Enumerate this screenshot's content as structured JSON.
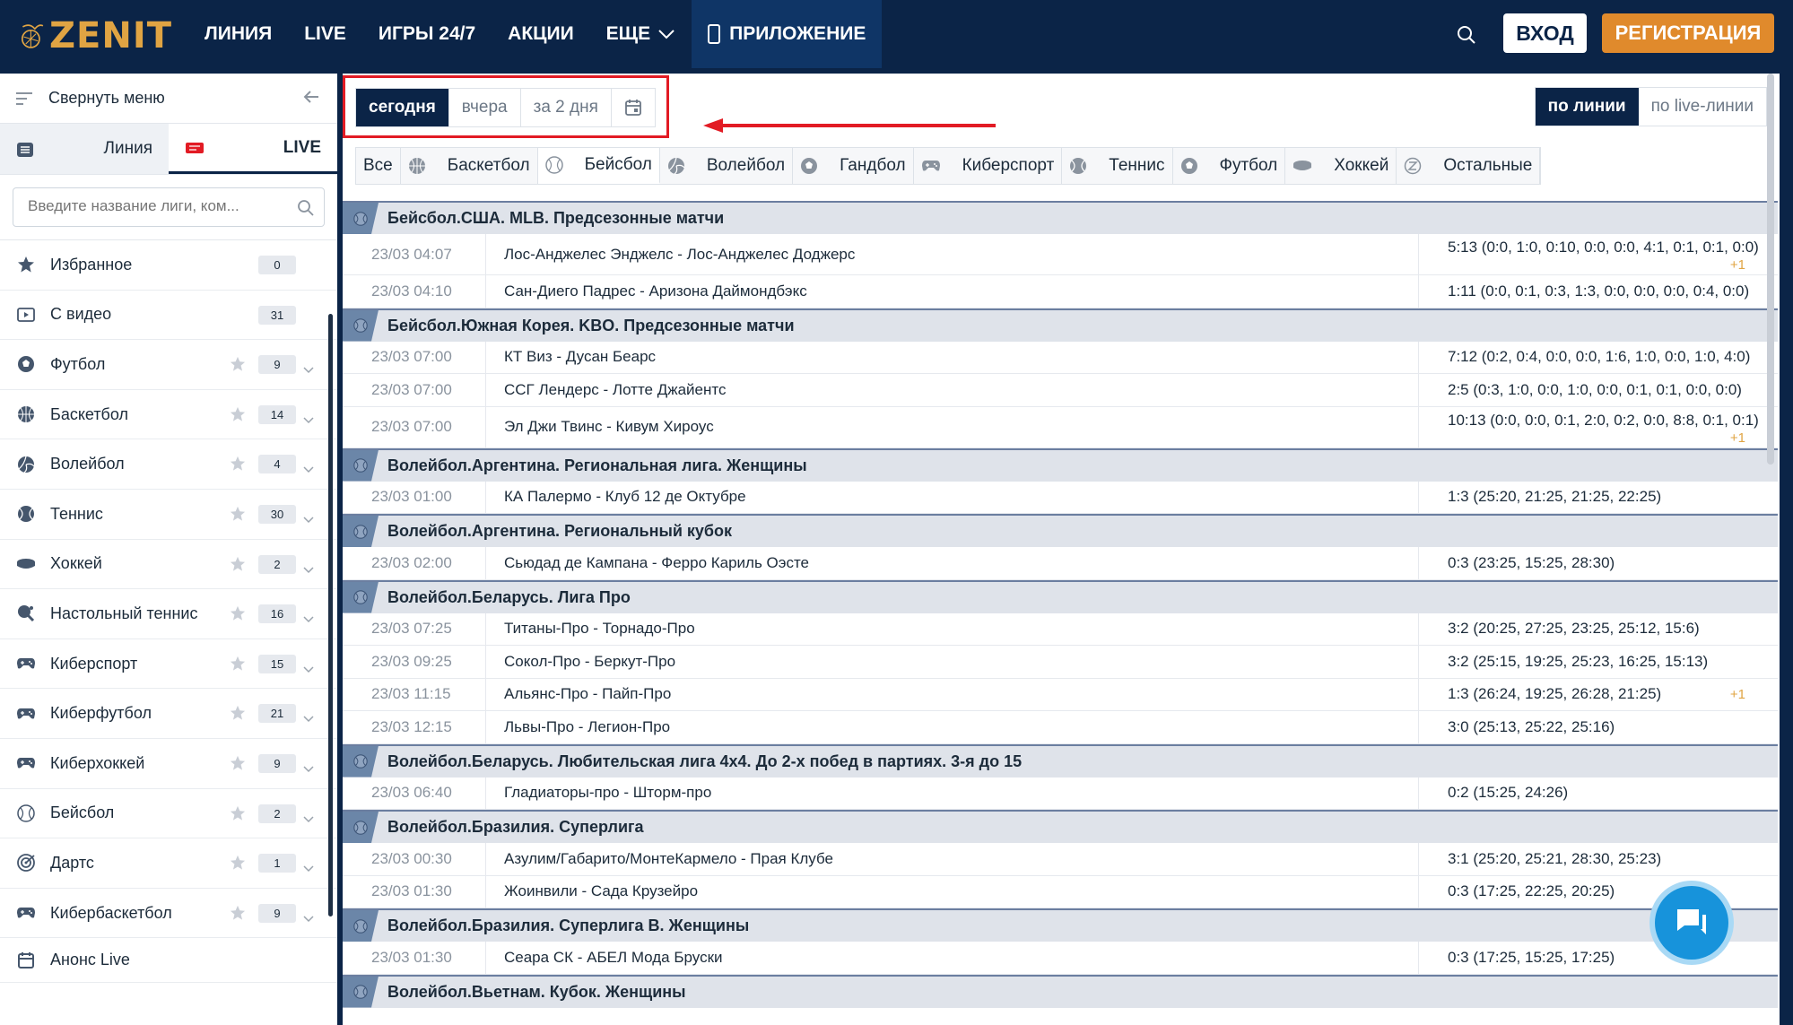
{
  "header": {
    "brand": "ZENIT",
    "nav": [
      "ЛИНИЯ",
      "LIVE",
      "ИГРЫ 24/7",
      "АКЦИИ",
      "ЕЩЕ"
    ],
    "app_label": "ПРИЛОЖЕНИЕ",
    "login_label": "ВХОД",
    "register_label": "РЕГИСТРАЦИЯ",
    "colors": {
      "bg": "#0b2447",
      "brand": "#e0a443",
      "register": "#e08a2c"
    }
  },
  "sidebar": {
    "collapse_label": "Свернуть меню",
    "tab_line": "Линия",
    "tab_live": "LIVE",
    "search_placeholder": "Введите название лиги, ком...",
    "items": [
      {
        "label": "Избранное",
        "count": "0",
        "icon": "star-icon",
        "star": false
      },
      {
        "label": "С видео",
        "count": "31",
        "icon": "video-icon",
        "star": false
      },
      {
        "label": "Футбол",
        "count": "9",
        "icon": "football-icon",
        "star": true
      },
      {
        "label": "Баскетбол",
        "count": "14",
        "icon": "basketball-icon",
        "star": true
      },
      {
        "label": "Волейбол",
        "count": "4",
        "icon": "volleyball-icon",
        "star": true
      },
      {
        "label": "Теннис",
        "count": "30",
        "icon": "tennis-icon",
        "star": true
      },
      {
        "label": "Хоккей",
        "count": "2",
        "icon": "hockey-icon",
        "star": true
      },
      {
        "label": "Настольный теннис",
        "count": "16",
        "icon": "table-tennis-icon",
        "star": true
      },
      {
        "label": "Киберспорт",
        "count": "15",
        "icon": "gamepad-icon",
        "star": true
      },
      {
        "label": "Киберфутбол",
        "count": "21",
        "icon": "gamepad-icon",
        "star": true
      },
      {
        "label": "Киберхоккей",
        "count": "9",
        "icon": "gamepad-icon",
        "star": true
      },
      {
        "label": "Бейсбол",
        "count": "2",
        "icon": "baseball-icon",
        "star": true
      },
      {
        "label": "Дартс",
        "count": "1",
        "icon": "darts-icon",
        "star": true
      },
      {
        "label": "Кибербаскетбол",
        "count": "9",
        "icon": "gamepad-icon",
        "star": true
      }
    ],
    "anons_label": "Анонс Live"
  },
  "filters": {
    "dates": [
      "сегодня",
      "вчера",
      "за 2 дня"
    ],
    "modes": [
      "по линии",
      "по live-линии"
    ]
  },
  "sport_tabs": [
    "Все",
    "Баскетбол",
    "Бейсбол",
    "Волейбол",
    "Гандбол",
    "Киберспорт",
    "Теннис",
    "Футбол",
    "Хоккей",
    "Остальные"
  ],
  "results": [
    {
      "league": "Бейсбол.США. MLB. Предсезонные матчи",
      "matches": [
        {
          "time": "23/03 04:07",
          "teams": "Лос-Анджелес Энджелс - Лос-Анджелес Доджерс",
          "score": "5:13 (0:0, 1:0, 0:10, 0:0, 0:0, 4:1, 0:1, 0:1, 0:0)",
          "plus": "+1"
        },
        {
          "time": "23/03 04:10",
          "teams": "Сан-Диего Падрес - Аризона Даймондбэкс",
          "score": "1:11 (0:0, 0:1, 0:3, 1:3, 0:0, 0:0, 0:0, 0:4, 0:0)",
          "plus": ""
        }
      ]
    },
    {
      "league": "Бейсбол.Южная Корея. KBO. Предсезонные матчи",
      "matches": [
        {
          "time": "23/03 07:00",
          "teams": "КТ Виз - Дусан Беарс",
          "score": "7:12 (0:2, 0:4, 0:0, 0:0, 1:6, 1:0, 0:0, 1:0, 4:0)",
          "plus": ""
        },
        {
          "time": "23/03 07:00",
          "teams": "ССГ Лендерс - Лотте Джайентс",
          "score": "2:5 (0:3, 1:0, 0:0, 1:0, 0:0, 0:1, 0:1, 0:0, 0:0)",
          "plus": ""
        },
        {
          "time": "23/03 07:00",
          "teams": "Эл Джи Твинс - Кивум Хироус",
          "score": "10:13 (0:0, 0:0, 0:1, 2:0, 0:2, 0:0, 8:8, 0:1, 0:1)",
          "plus": "+1"
        }
      ]
    },
    {
      "league": "Волейбол.Аргентина. Региональная лига. Женщины",
      "matches": [
        {
          "time": "23/03 01:00",
          "teams": "КА Палермо - Клуб 12 де Октубре",
          "score": "1:3 (25:20, 21:25, 21:25, 22:25)",
          "plus": ""
        }
      ]
    },
    {
      "league": "Волейбол.Аргентина. Региональный кубок",
      "matches": [
        {
          "time": "23/03 02:00",
          "teams": "Сьюдад де Кампана - Ферро Кариль Оэсте",
          "score": "0:3 (23:25, 15:25, 28:30)",
          "plus": ""
        }
      ]
    },
    {
      "league": "Волейбол.Беларусь. Лига Про",
      "matches": [
        {
          "time": "23/03 07:25",
          "teams": "Титаны-Про - Торнадо-Про",
          "score": "3:2 (20:25, 27:25, 23:25, 25:12, 15:6)",
          "plus": ""
        },
        {
          "time": "23/03 09:25",
          "teams": "Сокол-Про - Беркут-Про",
          "score": "3:2 (25:15, 19:25, 25:23, 16:25, 15:13)",
          "plus": ""
        },
        {
          "time": "23/03 11:15",
          "teams": "Альянс-Про - Пайп-Про",
          "score": "1:3 (26:24, 19:25, 26:28, 21:25)",
          "plus": "+1"
        },
        {
          "time": "23/03 12:15",
          "teams": "Львы-Про - Легион-Про",
          "score": "3:0 (25:13, 25:22, 25:16)",
          "plus": ""
        }
      ]
    },
    {
      "league": "Волейбол.Беларусь. Любительская лига 4х4. До 2-х побед в партиях. 3-я до 15",
      "matches": [
        {
          "time": "23/03 06:40",
          "teams": "Гладиаторы-про - Шторм-про",
          "score": "0:2 (15:25, 24:26)",
          "plus": ""
        }
      ]
    },
    {
      "league": "Волейбол.Бразилия. Суперлига",
      "matches": [
        {
          "time": "23/03 00:30",
          "teams": "Азулим/Габарито/МонтеКармело - Прая Клубе",
          "score": "3:1 (25:20, 25:21, 28:30, 25:23)",
          "plus": ""
        },
        {
          "time": "23/03 01:30",
          "teams": "Жоинвили - Сада Крузейро",
          "score": "0:3 (17:25, 22:25, 20:25)",
          "plus": ""
        }
      ]
    },
    {
      "league": "Волейбол.Бразилия. Суперлига В. Женщины",
      "matches": [
        {
          "time": "23/03 01:30",
          "teams": "Сеара СК - АБЕЛ Мода Бруски",
          "score": "0:3 (17:25, 15:25, 17:25)",
          "plus": ""
        }
      ]
    },
    {
      "league": "Волейбол.Вьетнам. Кубок. Женщины",
      "matches": []
    }
  ]
}
